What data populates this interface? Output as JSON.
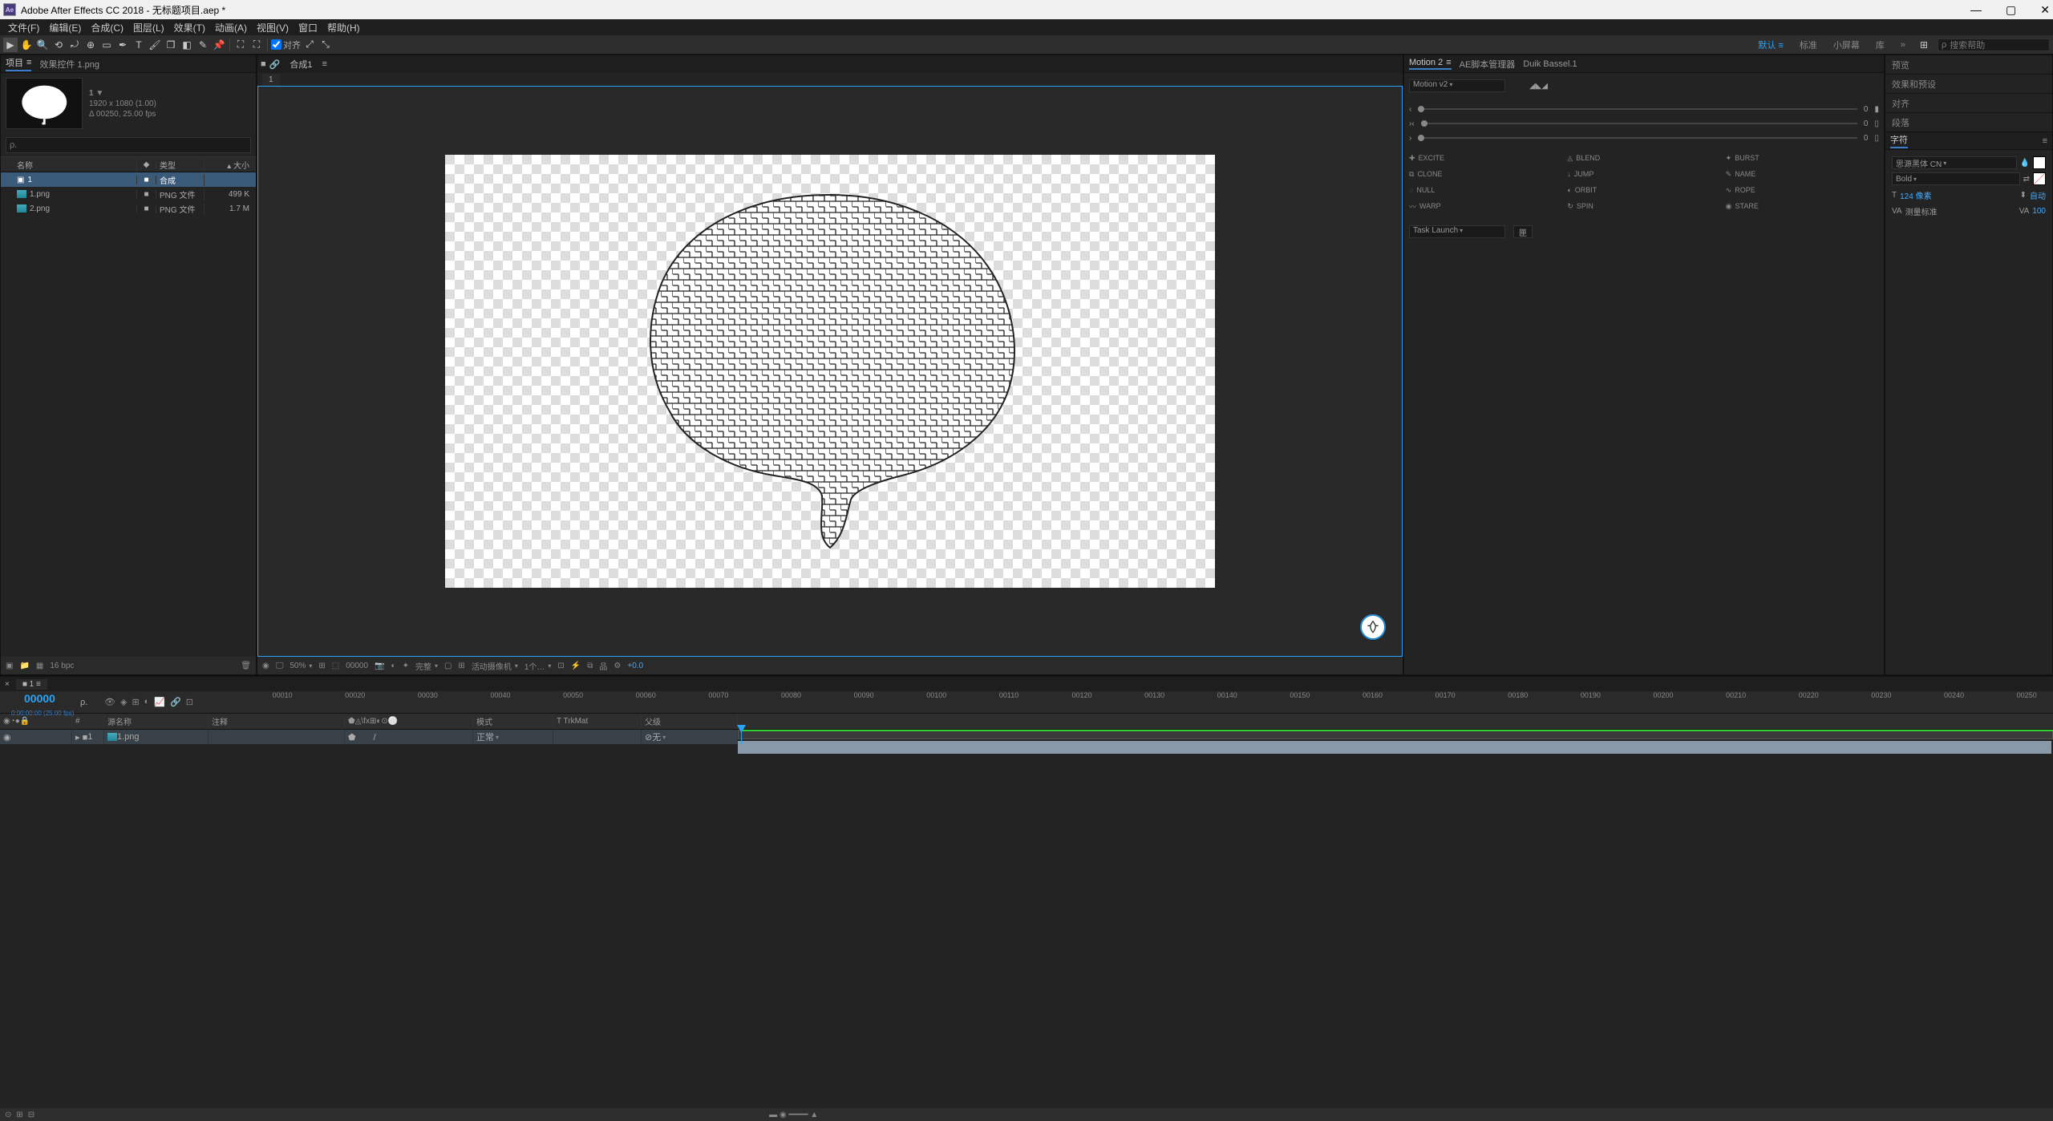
{
  "app": {
    "title": "Adobe After Effects CC 2018 - 无标题项目.aep *",
    "logo_text": "Ae"
  },
  "menu": [
    "文件(F)",
    "编辑(E)",
    "合成(C)",
    "图层(L)",
    "效果(T)",
    "动画(A)",
    "视图(V)",
    "窗口",
    "帮助(H)"
  ],
  "toolbar": {
    "snap_label": "对齐"
  },
  "workspace": {
    "items": [
      "默认",
      "标准",
      "小屏幕",
      "库"
    ],
    "active": "默认",
    "search_placeholder": "搜索帮助"
  },
  "project": {
    "tab1": "项目",
    "tab2": "效果控件 1.png",
    "preview": {
      "name": "1",
      "type": "▼",
      "dims": "1920 x 1080 (1.00)",
      "dur": "Δ 00250, 25.00 fps"
    },
    "search_placeholder": "ρ.",
    "columns": {
      "name": "名称",
      "tag": "◆",
      "type": "类型",
      "size": "大小"
    },
    "items": [
      {
        "name": "1",
        "type": "合成",
        "size": ""
      },
      {
        "name": "1.png",
        "type": "PNG 文件",
        "size": "499 K"
      },
      {
        "name": "2.png",
        "type": "PNG 文件",
        "size": "1.7 M"
      }
    ],
    "bottom_bpc": "16 bpc"
  },
  "composition": {
    "tab_lock": "■",
    "tab_name": "合成1",
    "tab_close": "≡",
    "layer_tab": "1",
    "controls": {
      "zoom": "50%",
      "time": "00000",
      "res": "完整",
      "camera": "活动摄像机",
      "views": "1个…",
      "exp": "+0.0"
    }
  },
  "motion2": {
    "tabs": [
      "Motion 2",
      "AE脚本管理器",
      "Duik Bassel.1"
    ],
    "dropdown": "Motion v2",
    "sliders": [
      {
        "icon": "‹",
        "val": "0"
      },
      {
        "icon": "›‹",
        "val": "0"
      },
      {
        "icon": "›",
        "val": "0"
      }
    ],
    "buttons": [
      {
        "icon": "✚",
        "label": "EXCITE"
      },
      {
        "icon": "◬",
        "label": "BLEND"
      },
      {
        "icon": "✦",
        "label": "BURST"
      },
      {
        "icon": "⧉",
        "label": "CLONE"
      },
      {
        "icon": "↓",
        "label": "JUMP"
      },
      {
        "icon": "✎",
        "label": "NAME"
      },
      {
        "icon": "◌",
        "label": "NULL"
      },
      {
        "icon": "◐",
        "label": "ORBIT"
      },
      {
        "icon": "∿",
        "label": "ROPE"
      },
      {
        "icon": "〰",
        "label": "WARP"
      },
      {
        "icon": "↻",
        "label": "SPIN"
      },
      {
        "icon": "◉",
        "label": "STARE"
      }
    ],
    "task_launch": "Task Launch",
    "task_btn": "匣"
  },
  "right_panels": {
    "preview": "预览",
    "effects": "效果和预设",
    "align": "对齐",
    "paragraph": "段落",
    "character": "字符"
  },
  "character": {
    "font": "思源黑体 CN",
    "style": "Bold",
    "size_label": "124 像素",
    "auto": "自动",
    "tracking": "测量标准",
    "va": "100"
  },
  "timeline": {
    "tab": "1",
    "timecode": "00000",
    "timecode_sub": "0:00:00:00 (25.00 fps)",
    "search": "ρ.",
    "columns": {
      "av": "",
      "idx": "#",
      "name": "源名称",
      "comment": "注释",
      "switches": "⬟◬\\fx⊞◐⊙⚪",
      "mode": "模式",
      "trkmat": "T   TrkMat",
      "parent": "父级"
    },
    "columns_widths": {
      "av": 90,
      "idx": 40,
      "name": 130,
      "comment": 170,
      "switches": 160,
      "mode": 100,
      "trkmat": 110,
      "parent": 120
    },
    "ruler_ticks": [
      "00010",
      "00020",
      "00030",
      "00040",
      "00050",
      "00060",
      "00070",
      "00080",
      "00090",
      "00100",
      "00110",
      "00120",
      "00130",
      "00140",
      "00150",
      "00160",
      "00170",
      "00180",
      "00190",
      "00200",
      "00210",
      "00220",
      "00230",
      "00240",
      "00250"
    ],
    "layers": [
      {
        "idx": "1",
        "name": "1.png",
        "mode": "正常",
        "parent": "无"
      }
    ]
  }
}
